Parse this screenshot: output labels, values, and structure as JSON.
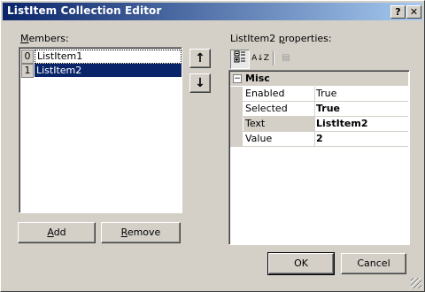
{
  "window": {
    "title": "ListItem Collection Editor",
    "help_label": "?",
    "close_label": "✕"
  },
  "members": {
    "label_prefix": "",
    "label_accel": "M",
    "label_rest": "embers:",
    "items": [
      {
        "index": "0",
        "text": "ListItem1"
      },
      {
        "index": "1",
        "text": "ListItem2"
      }
    ],
    "selected_index": 1
  },
  "move_buttons": {
    "up_icon": "↑",
    "down_icon": "↓"
  },
  "actions": {
    "add_accel": "A",
    "add_rest": "dd",
    "remove_accel": "R",
    "remove_rest": "emove"
  },
  "properties": {
    "label_pre": "ListItem2 ",
    "label_accel": "p",
    "label_rest": "roperties:",
    "toolbar": {
      "categorized_icon": "categorized-icon",
      "alphabetical_icon": "alphabetical-icon",
      "alpha_glyph": "A↓Z",
      "pages_icon": "property-pages-icon",
      "pages_glyph": "▤"
    },
    "category": {
      "toggle": "−",
      "name": "Misc"
    },
    "rows": [
      {
        "name": "Enabled",
        "value": "True",
        "bold": false
      },
      {
        "name": "Selected",
        "value": "True",
        "bold": true
      },
      {
        "name": "Text",
        "value": "ListItem2",
        "bold": true
      },
      {
        "name": "Value",
        "value": "2",
        "bold": true
      }
    ],
    "selected_row": 2
  },
  "dialog_buttons": {
    "ok_label": "OK",
    "cancel_label": "Cancel"
  }
}
